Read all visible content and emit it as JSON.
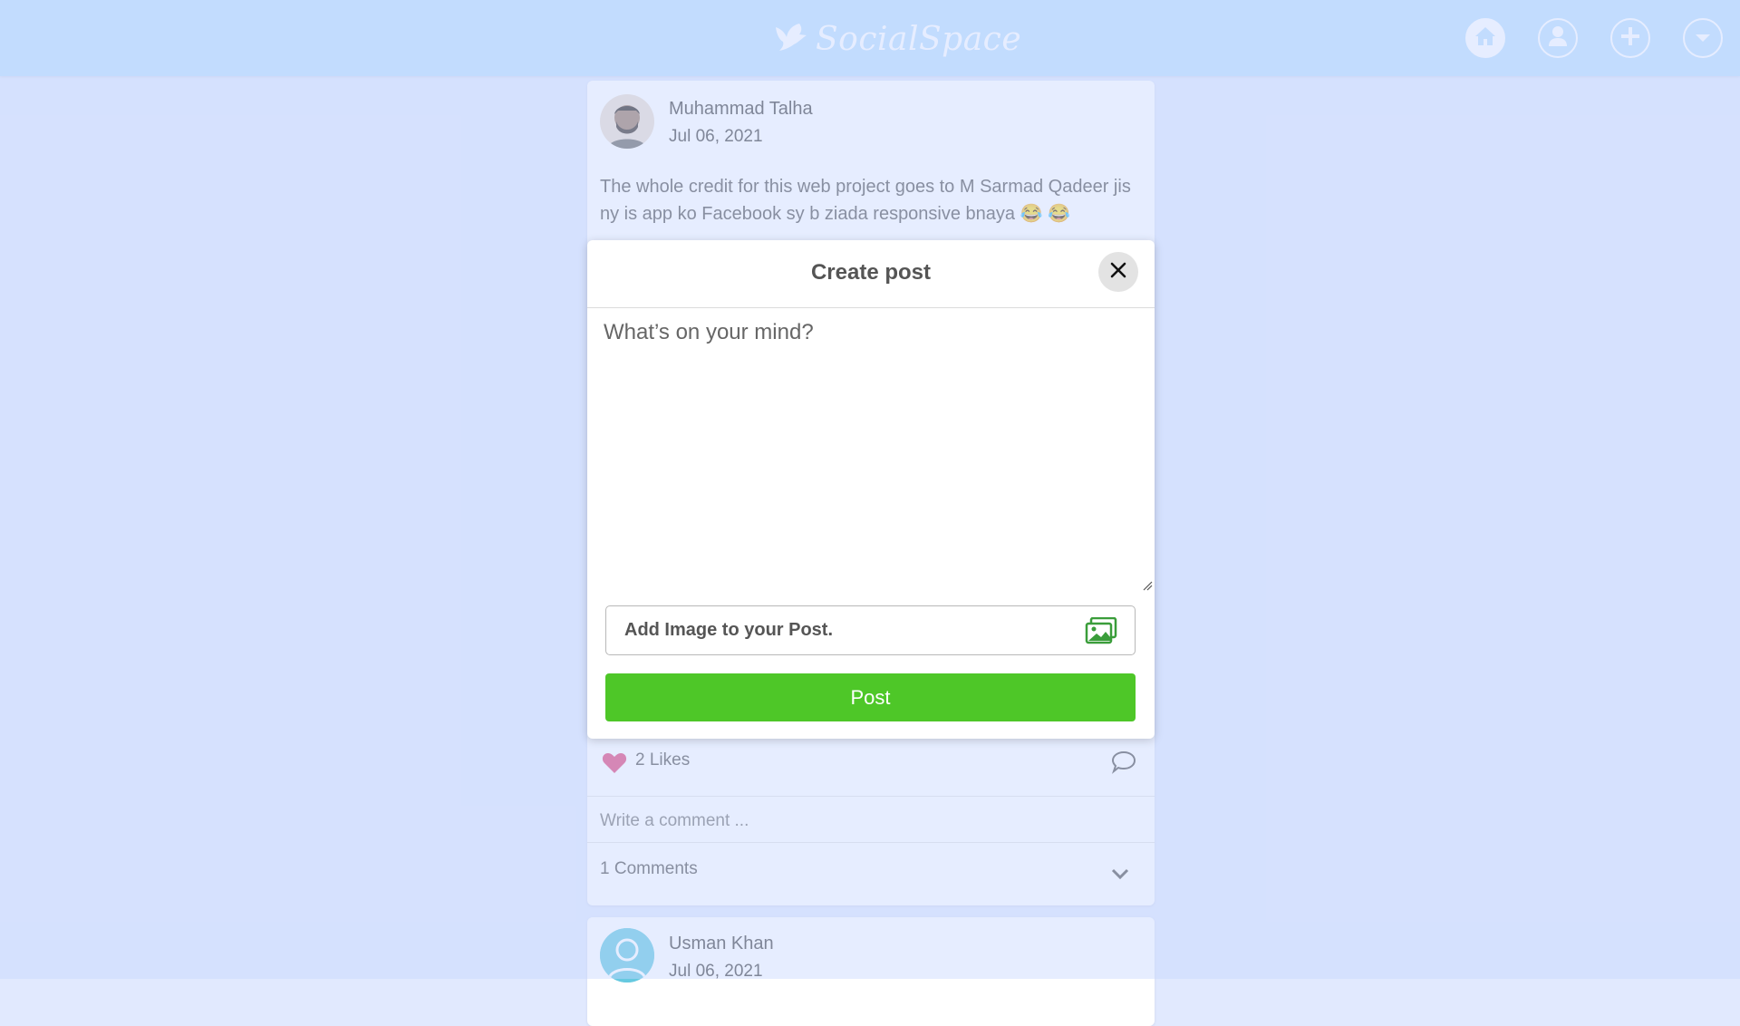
{
  "nav": {
    "brand": "SocialSpace",
    "buttons": [
      {
        "icon": "home-icon"
      },
      {
        "icon": "profile-icon"
      },
      {
        "icon": "add-icon"
      },
      {
        "icon": "dropdown-icon"
      }
    ]
  },
  "feed": {
    "posts": [
      {
        "author": "Muhammad Talha",
        "date": "Jul 06, 2021",
        "text": "The whole credit for this web project goes to M Sarmad Qadeer jis ny is app ko Facebook sy b ziada responsive bnaya 😂 😂",
        "likes": "2 Likes",
        "comment_placeholder": "Write a comment ...",
        "comments": "1 Comments"
      },
      {
        "author": "Usman Khan",
        "date": "Jul 06, 2021"
      }
    ]
  },
  "modal": {
    "title": "Create post",
    "textarea_placeholder": "What’s on your mind?",
    "image_label": "Add Image to your Post.",
    "post_button": "Post"
  },
  "colors": {
    "nav_bg": "#bee1fe",
    "page_bg": "#e1e9fe",
    "post_button": "#4ec728",
    "like_heart": "#e0457b",
    "image_icon": "#3a9d3a"
  }
}
